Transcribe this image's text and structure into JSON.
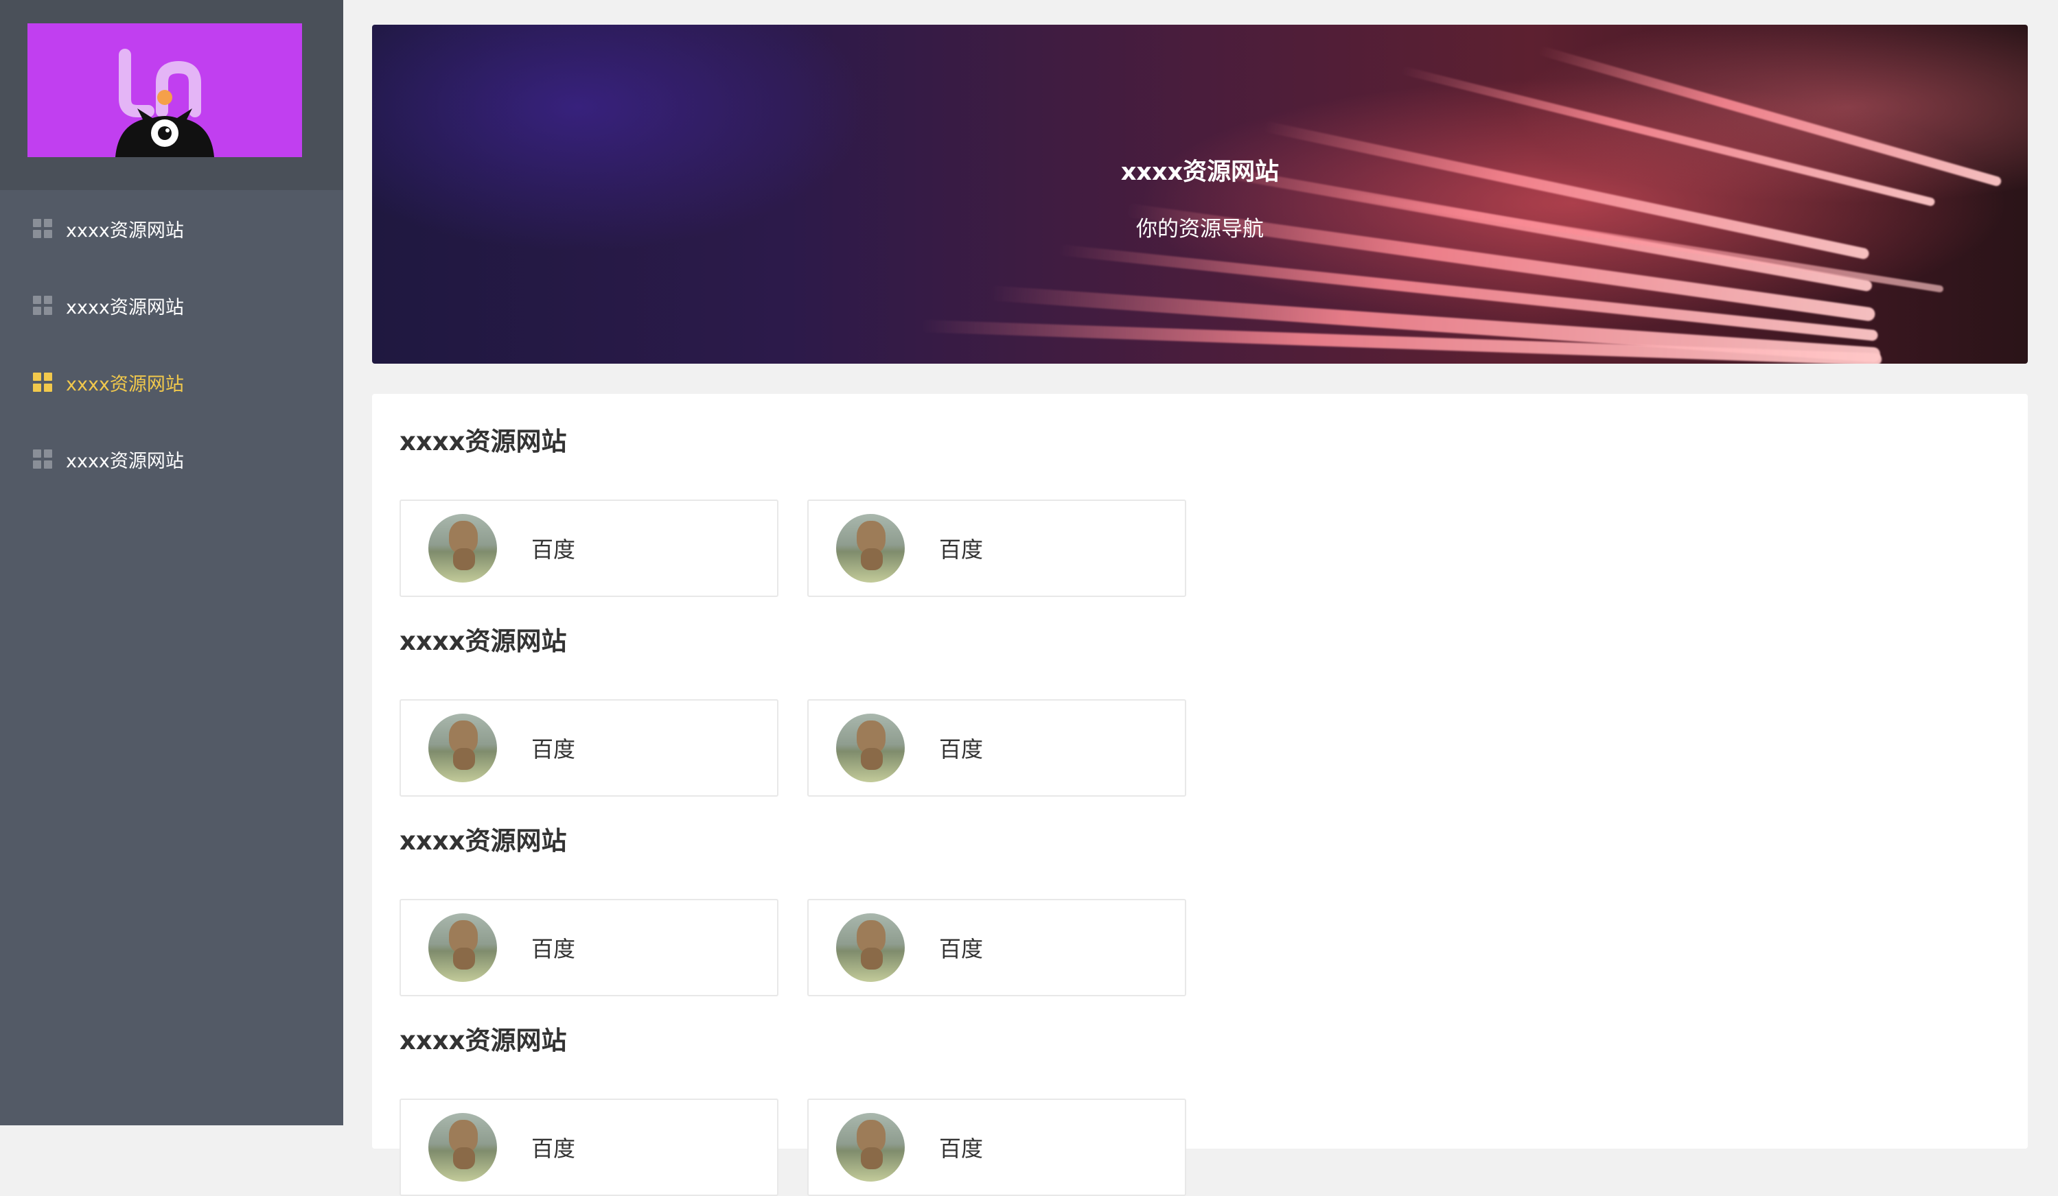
{
  "sidebar": {
    "logo_icon": "ln-monster-logo",
    "items": [
      {
        "label": "xxxx资源网站",
        "icon": "grid-icon",
        "active": false
      },
      {
        "label": "xxxx资源网站",
        "icon": "grid-icon",
        "active": false
      },
      {
        "label": "xxxx资源网站",
        "icon": "grid-icon",
        "active": true
      },
      {
        "label": "xxxx资源网站",
        "icon": "grid-icon",
        "active": false
      }
    ]
  },
  "banner": {
    "title": "xxxx资源网站",
    "subtitle": "你的资源导航"
  },
  "sections": [
    {
      "title": "xxxx资源网站",
      "links": [
        {
          "label": "百度"
        },
        {
          "label": "百度"
        }
      ]
    },
    {
      "title": "xxxx资源网站",
      "links": [
        {
          "label": "百度"
        },
        {
          "label": "百度"
        }
      ]
    },
    {
      "title": "xxxx资源网站",
      "links": [
        {
          "label": "百度"
        },
        {
          "label": "百度"
        }
      ]
    },
    {
      "title": "xxxx资源网站",
      "links": [
        {
          "label": "百度"
        },
        {
          "label": "百度"
        }
      ]
    }
  ],
  "colors": {
    "sidebar_bg": "#535a66",
    "active": "#f2c94c",
    "logo_bg": "#c13ff0"
  }
}
